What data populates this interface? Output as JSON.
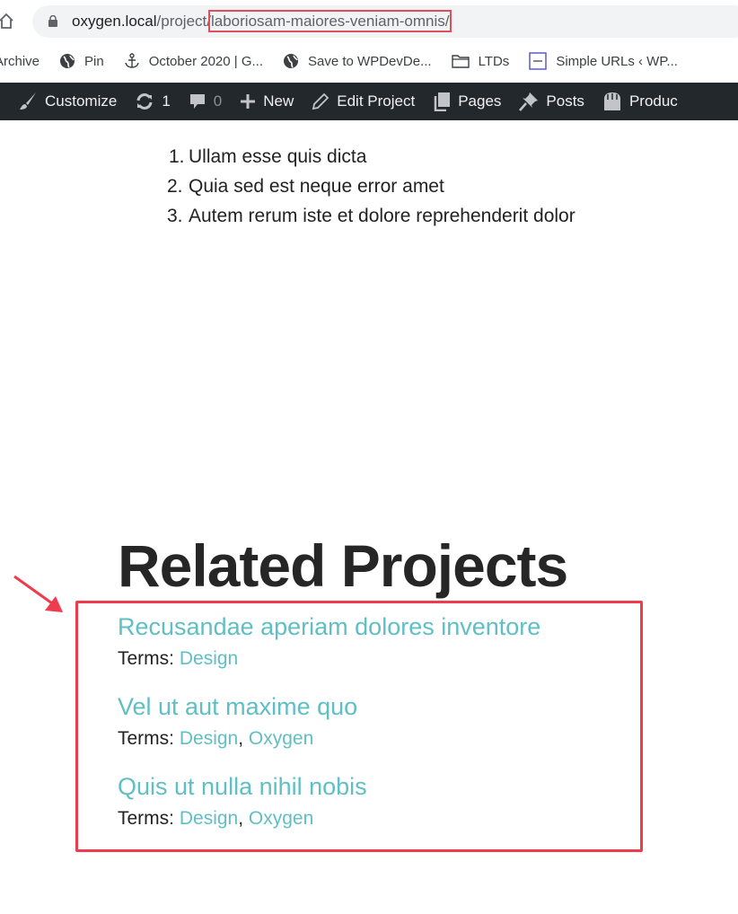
{
  "browser": {
    "url_host": "oxygen.local",
    "url_path_prefix": "/project/",
    "url_slug": "laboriosam-maiores-veniam-omnis/",
    "bookmarks": [
      {
        "label": "Archive",
        "icon": "none"
      },
      {
        "label": "Pin",
        "icon": "globe-icon"
      },
      {
        "label": "October 2020 | G...",
        "icon": "anchor-icon"
      },
      {
        "label": "Save to WPDevDe...",
        "icon": "globe-icon"
      },
      {
        "label": "LTDs",
        "icon": "folder-icon"
      },
      {
        "label": "Simple URLs ‹ WP...",
        "icon": "wpdd-favicon-icon"
      }
    ]
  },
  "adminbar": {
    "customize": "Customize",
    "updates_count": "1",
    "comments_count": "0",
    "new": "New",
    "edit": "Edit Project",
    "pages": "Pages",
    "posts": "Posts",
    "products": "Produc"
  },
  "list": [
    {
      "num": "1.",
      "text": "Ullam esse quis dicta"
    },
    {
      "num": "2.",
      "text": "Quia sed est neque error amet"
    },
    {
      "num": "3.",
      "text": "Autem rerum iste et dolore reprehenderit dolor"
    }
  ],
  "related": {
    "heading": "Related Projects",
    "terms_label": "Terms: ",
    "separator": ", ",
    "projects": [
      {
        "title": "Recusandae aperiam dolores inventore",
        "terms": [
          "Design"
        ]
      },
      {
        "title": "Vel ut aut maxime quo",
        "terms": [
          "Design",
          "Oxygen"
        ]
      },
      {
        "title": "Quis ut nulla nihil nobis",
        "terms": [
          "Design",
          "Oxygen"
        ]
      }
    ]
  },
  "colors": {
    "accent": "#5fbfc4",
    "highlight": "#ee3b4d",
    "adminbar_bg": "#23282d"
  }
}
